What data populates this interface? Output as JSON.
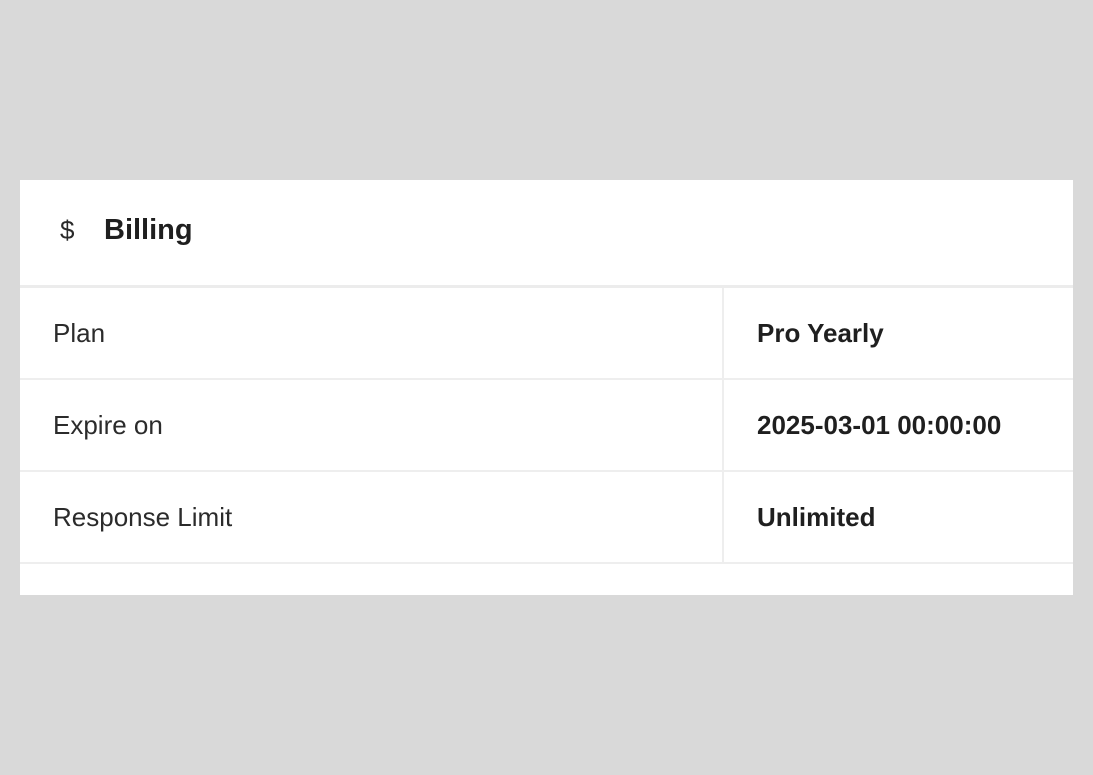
{
  "billing": {
    "icon": "dollar-icon",
    "icon_glyph": "$",
    "title": "Billing",
    "rows": [
      {
        "label": "Plan",
        "value": "Pro Yearly"
      },
      {
        "label": "Expire on",
        "value": "2025-03-01 00:00:00"
      },
      {
        "label": "Response Limit",
        "value": "Unlimited"
      }
    ]
  }
}
